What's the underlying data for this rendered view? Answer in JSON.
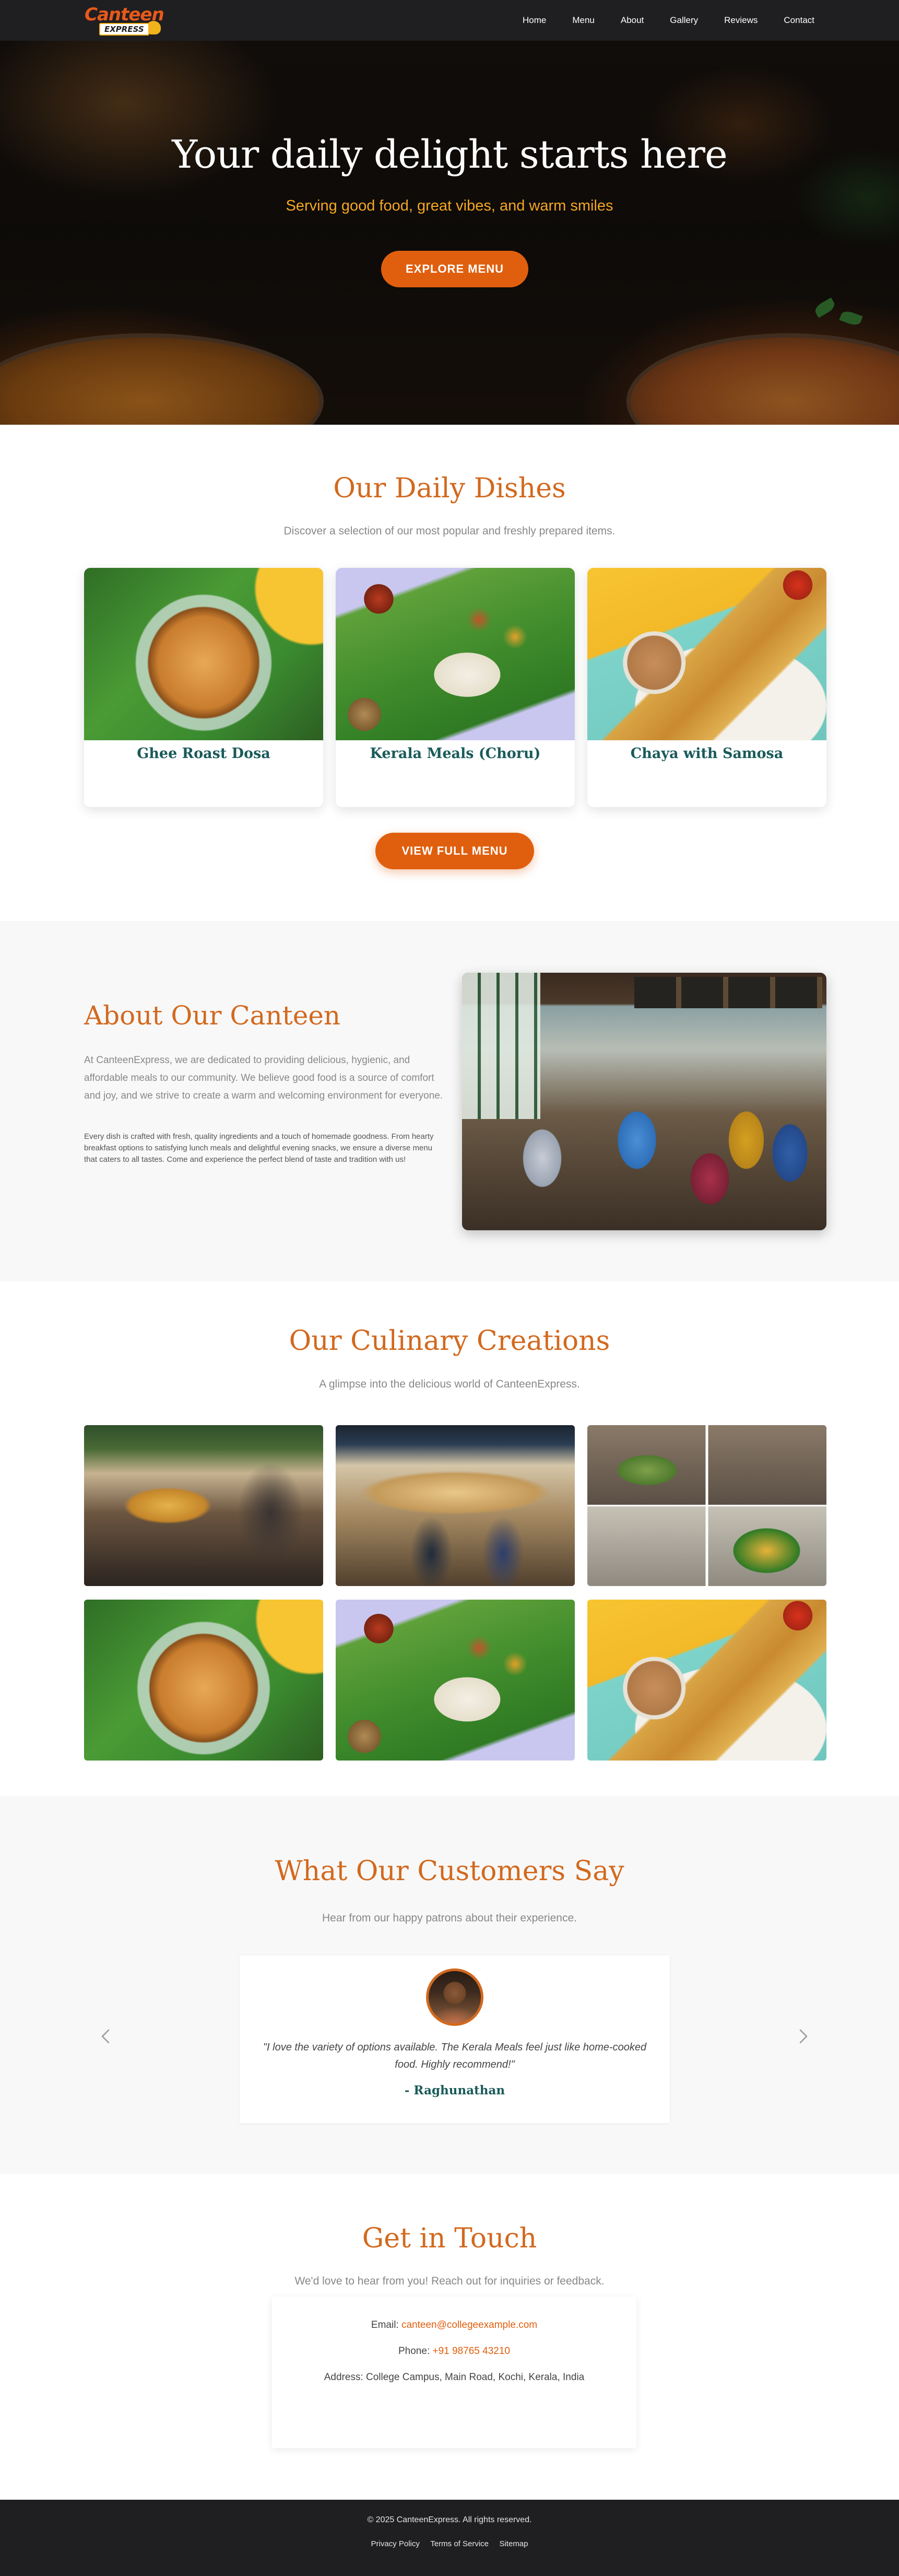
{
  "brand": {
    "name_top": "Canteen",
    "name_bottom": "EXPRESS"
  },
  "nav": {
    "items": [
      {
        "label": "Home"
      },
      {
        "label": "Menu"
      },
      {
        "label": "About"
      },
      {
        "label": "Gallery"
      },
      {
        "label": "Reviews"
      },
      {
        "label": "Contact"
      }
    ]
  },
  "hero": {
    "title": "Your daily delight starts here",
    "subtitle": "Serving good food, great vibes, and warm smiles",
    "button_label": "EXPLORE MENU"
  },
  "dishes": {
    "title": "Our Daily Dishes",
    "subtitle": "Discover a selection of our most popular and freshly prepared items.",
    "items": [
      {
        "name": "Ghee Roast Dosa"
      },
      {
        "name": "Kerala Meals (Choru)"
      },
      {
        "name": "Chaya with Samosa"
      }
    ],
    "button_label": "VIEW FULL MENU"
  },
  "about": {
    "title": "About Our Canteen",
    "paragraph1": "At CanteenExpress, we are dedicated to providing delicious, hygienic, and affordable meals to our community. We believe good food is a source of comfort and joy, and we strive to create a warm and welcoming environment for everyone.",
    "paragraph2": "Every dish is crafted with fresh, quality ingredients and a touch of homemade goodness. From hearty breakfast options to satisfying lunch meals and delightful evening snacks, we ensure a diverse menu that caters to all tastes. Come and experience the perfect blend of taste and tradition with us!"
  },
  "gallery": {
    "title": "Our Culinary Creations",
    "subtitle": "A glimpse into the delicious world of CanteenExpress."
  },
  "reviews": {
    "title": "What Our Customers Say",
    "subtitle": "Hear from our happy patrons about their experience.",
    "quote": "\"I love the variety of options available. The Kerala Meals feel just like home-cooked food. Highly recommend!\"",
    "author": "- Raghunathan"
  },
  "contact": {
    "title": "Get in Touch",
    "subtitle": "We'd love to hear from you! Reach out for inquiries or feedback.",
    "email_label": "Email:",
    "email_value": "canteen@collegeexample.com",
    "phone_label": "Phone:",
    "phone_value": "+91 98765 43210",
    "address": "Address: College Campus, Main Road, Kochi, Kerala, India"
  },
  "footer": {
    "copyright": "© 2025 CanteenExpress. All rights reserved.",
    "links": [
      {
        "label": "Privacy Policy"
      },
      {
        "label": "Terms of Service"
      },
      {
        "label": "Sitemap"
      }
    ]
  },
  "colors": {
    "accent": "#e05f0e",
    "heading": "#d2691e",
    "dish_name": "#1a5a5a",
    "hero_subtitle": "#f5a623",
    "nav_bg": "#1f1f21"
  },
  "icons": {
    "prev": "chevron-left-icon",
    "next": "chevron-right-icon"
  }
}
